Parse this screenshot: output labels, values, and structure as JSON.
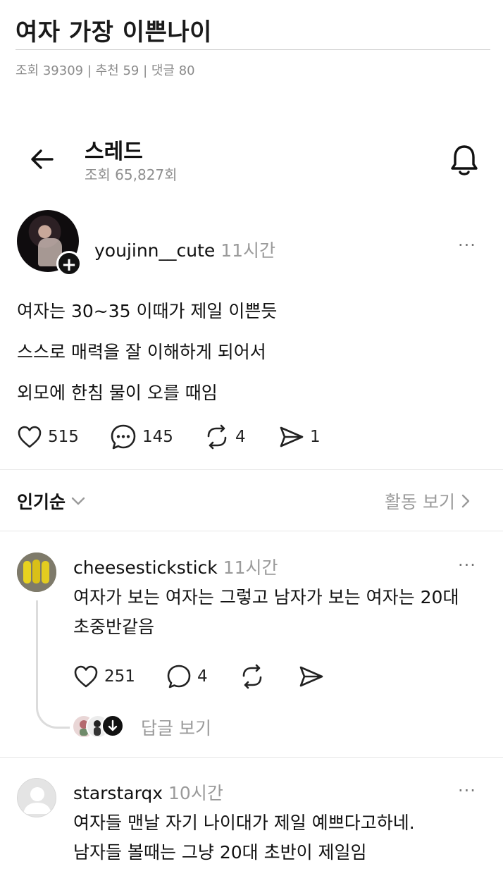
{
  "post": {
    "title": "여자 가장 이쁜나이",
    "meta": "조회 39309 | 추천 59 | 댓글 80"
  },
  "header": {
    "title": "스레드",
    "views": "조회 65,827회",
    "icons": [
      "back-arrow-icon",
      "bell-icon"
    ]
  },
  "thread": {
    "username": "youjinn__cute",
    "time": "11시간",
    "more": "···",
    "lines": [
      "여자는 30~35 이때가 제일 이쁜듯",
      "스스로 매력을 잘 이해하게 되어서",
      "외모에 한침 물이 오를 때임"
    ],
    "stats": {
      "likes": "515",
      "comments": "145",
      "reposts": "4",
      "shares": "1"
    }
  },
  "sort": {
    "label": "인기순",
    "activity": "활동 보기"
  },
  "comments": [
    {
      "username": "cheesestickstick",
      "time": "11시간",
      "more": "···",
      "lines": [
        "여자가 보는 여자는 그렇고 남자가 보는 여자는 20대",
        "초중반같음"
      ],
      "likes": "251",
      "replies": "4",
      "reply_view": "답글 보기"
    },
    {
      "username": "starstarqx",
      "time": "10시간",
      "more": "···",
      "lines": [
        "여자들 맨날 자기 나이대가 제일 예쁘다고하네.",
        "남자들 볼때는 그냥 20대 초반이 제일임"
      ]
    }
  ],
  "colors": {
    "text": "#111111",
    "muted": "#9a9a9a",
    "divider": "#e6e6e6"
  }
}
